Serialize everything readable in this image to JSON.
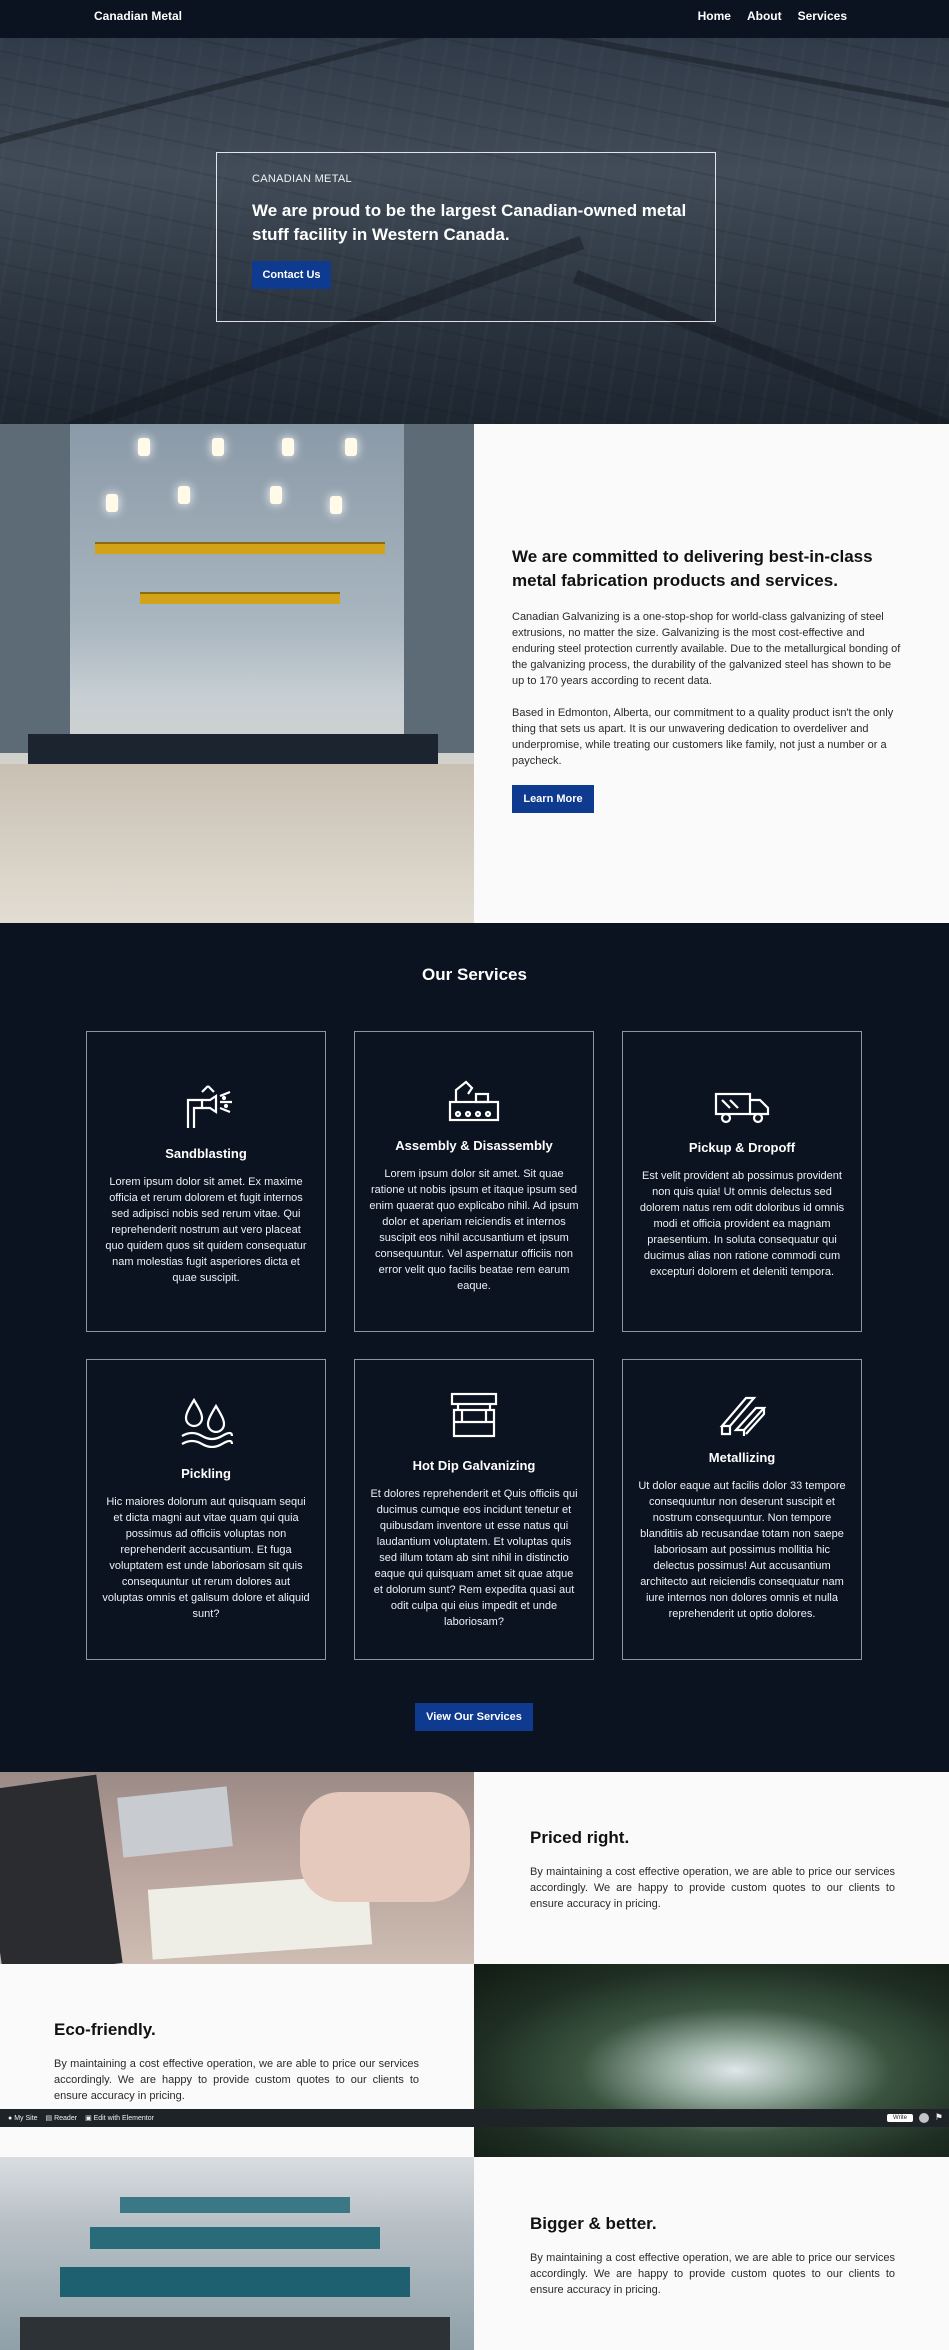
{
  "nav": {
    "brand": "Canadian Metal",
    "links": [
      "Home",
      "About",
      "Services"
    ]
  },
  "hero": {
    "eyebrow": "CANADIAN METAL",
    "headline": "We are proud to be the largest Canadian-owned metal stuff facility in Western Canada.",
    "cta": "Contact Us"
  },
  "about": {
    "heading": "We are committed to delivering best-in-class metal fabrication products and services.",
    "p1": "Canadian Galvanizing is a one-stop-shop for world-class galvanizing of steel extrusions, no matter the size. Galvanizing is the most cost-effective and enduring steel protection currently available. Due to the metallurgical bonding of the galvanizing process, the durability of the galvanized steel has shown to be up to 170 years according to recent data.",
    "p2": "Based in Edmonton, Alberta, our commitment to a quality product isn't the only thing that sets us apart. It is our unwavering dedication to overdeliver and underpromise, while treating our customers like family, not just a number or a paycheck.",
    "button": "Learn More"
  },
  "services": {
    "title": "Our Services",
    "cards": [
      {
        "icon": "sandblast-nozzle-icon",
        "title": "Sandblasting",
        "body": "Lorem ipsum dolor sit amet. Ex maxime officia et rerum dolorem et fugit internos sed adipisci nobis sed rerum vitae. Qui reprehenderit nostrum aut vero placeat quo quidem quos sit quidem consequatur nam molestias fugit asperiores dicta et quae suscipit."
      },
      {
        "icon": "assembly-machine-icon",
        "title": "Assembly & Disassembly",
        "body": "Lorem ipsum dolor sit amet. Sit quae ratione ut nobis ipsum et itaque ipsum sed enim quaerat quo explicabo nihil. Ad ipsum dolor et aperiam reiciendis et internos suscipit eos nihil accusantium et ipsum consequuntur. Vel aspernatur officiis non error velit quo facilis beatae rem earum eaque."
      },
      {
        "icon": "delivery-truck-icon",
        "title": "Pickup & Dropoff",
        "body": "Est velit provident ab possimus provident non quis quia! Ut omnis delectus sed dolorem natus rem odit doloribus id omnis modi et officia provident ea magnam praesentium. In soluta consequatur qui ducimus alias non ratione commodi cum excepturi dolorem et deleniti tempora."
      },
      {
        "icon": "acid-drops-icon",
        "title": "Pickling",
        "body": "Hic maiores dolorum aut quisquam sequi et dicta magni aut vitae quam qui quia possimus ad officiis voluptas non reprehenderit accusantium. Et fuga voluptatem est unde laboriosam sit quis consequuntur ut rerum dolores aut voluptas omnis et galisum dolore et aliquid sunt?"
      },
      {
        "icon": "galvanizing-bath-icon",
        "title": "Hot Dip Galvanizing",
        "body": "Et dolores reprehenderit et Quis officiis qui ducimus cumque eos incidunt tenetur et quibusdam inventore ut esse natus qui laudantium voluptatem. Et voluptas quis sed illum totam ab sint nihil in distinctio eaque qui quisquam amet sit quae atque et dolorum sunt? Rem expedita quasi aut odit culpa qui eius impedit et unde laboriosam?"
      },
      {
        "icon": "metal-beams-icon",
        "title": "Metallizing",
        "body": "Ut dolor eaque aut facilis dolor 33 tempore consequuntur non deserunt suscipit et nostrum consequuntur. Non tempore blanditiis ab recusandae totam non saepe laboriosam aut possimus mollitia hic delectus possimus! Aut accusantium architecto aut reiciendis consequatur nam iure internos non dolores omnis et nulla reprehenderit ut optio dolores."
      }
    ],
    "button": "View Our Services"
  },
  "features": [
    {
      "title": "Priced right.",
      "body": "By maintaining a cost effective operation, we are able to price our services accordingly. We are happy to provide custom quotes to our clients to ensure accuracy in pricing."
    },
    {
      "title": "Eco-friendly.",
      "body": "By maintaining a cost effective operation, we are able to price our services accordingly. We are happy to provide custom quotes to our clients to ensure accuracy in pricing."
    },
    {
      "title": "Bigger & better.",
      "body": "By maintaining a cost effective operation, we are able to price our services accordingly. We are happy to provide custom quotes to our clients to ensure accuracy in pricing."
    }
  ],
  "adminbar": {
    "my_site": "My Site",
    "reader": "Reader",
    "edit": "Edit with Elementor",
    "write": "Write"
  }
}
